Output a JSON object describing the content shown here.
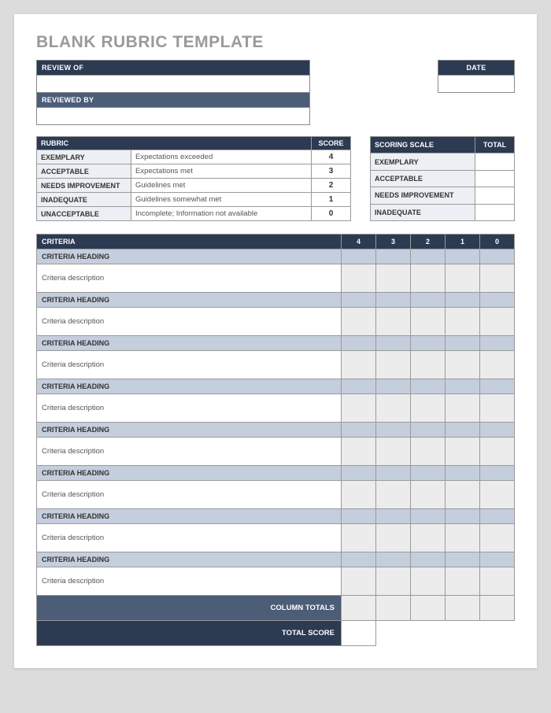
{
  "title": "BLANK RUBRIC TEMPLATE",
  "header": {
    "review_of": "REVIEW OF",
    "reviewed_by": "REVIEWED BY",
    "date": "DATE"
  },
  "rubric": {
    "header_label": "RUBRIC",
    "header_score": "SCORE",
    "rows": [
      {
        "label": "EXEMPLARY",
        "desc": "Expectations exceeded",
        "score": "4"
      },
      {
        "label": "ACCEPTABLE",
        "desc": "Expectations met",
        "score": "3"
      },
      {
        "label": "NEEDS IMPROVEMENT",
        "desc": "Guidelines met",
        "score": "2"
      },
      {
        "label": "INADEQUATE",
        "desc": "Guidelines somewhat met",
        "score": "1"
      },
      {
        "label": "UNACCEPTABLE",
        "desc": "Incomplete; Information not available",
        "score": "0"
      }
    ]
  },
  "scale": {
    "header_label": "SCORING SCALE",
    "header_total": "TOTAL",
    "rows": [
      {
        "label": "EXEMPLARY"
      },
      {
        "label": "ACCEPTABLE"
      },
      {
        "label": "NEEDS IMPROVEMENT"
      },
      {
        "label": "INADEQUATE"
      }
    ]
  },
  "criteria": {
    "header": "CRITERIA",
    "cols": [
      "4",
      "3",
      "2",
      "1",
      "0"
    ],
    "heading_text": "CRITERIA HEADING",
    "desc_text": "Criteria description",
    "count": 8,
    "column_totals": "COLUMN TOTALS",
    "total_score": "TOTAL SCORE"
  }
}
